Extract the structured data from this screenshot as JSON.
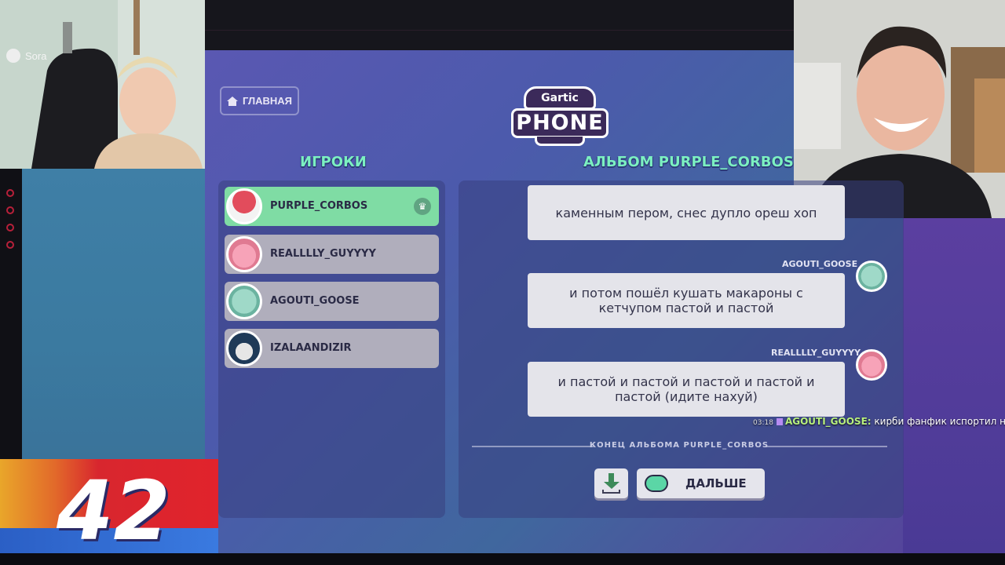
{
  "overlay": {
    "cam_left_label": "Sora",
    "counter_value": "42"
  },
  "header": {
    "home_label": "ГЛАВНАЯ",
    "logo_top": "Gartic",
    "logo_main": "PHONE"
  },
  "players": {
    "title": "ИГРОКИ",
    "items": [
      {
        "name": "PURPLE_CORBOS",
        "avatar": "mushroom-avatar",
        "active": true,
        "host_icon": "crown-icon"
      },
      {
        "name": "REALLLLY_GUYYYY",
        "avatar": "pig-avatar",
        "active": false
      },
      {
        "name": "AGOUTI_GOOSE",
        "avatar": "ghost-avatar",
        "active": false
      },
      {
        "name": "IZALAANDIZIR",
        "avatar": "skull-avatar",
        "active": false
      }
    ]
  },
  "album": {
    "title": "АЛЬБОМ PURPLE_CORBOS",
    "entries": [
      {
        "author": "",
        "text": "каменным пером, снес дупло ореш хоп"
      },
      {
        "author": "AGOUTI_GOOSE",
        "text": "и потом пошёл кушать макароны с кетчупом пастой и пастой"
      },
      {
        "author": "REALLLLY_GUYYYY",
        "text": "и пастой и пастой и пастой и пастой и пастой (идите нахуй)"
      }
    ],
    "end_label": "КОНЕЦ АЛЬБОМА PURPLE_CORBOS",
    "next_label": "ДАЛЬШЕ"
  },
  "chat": {
    "time": "03:18",
    "user": "AGOUTI_GOOSE:",
    "message": "кирби фанфик испортил нахуй"
  },
  "colors": {
    "accent_green": "#7cf0c1",
    "active_player": "#7fdca4",
    "inactive_player": "#b0aebc"
  }
}
